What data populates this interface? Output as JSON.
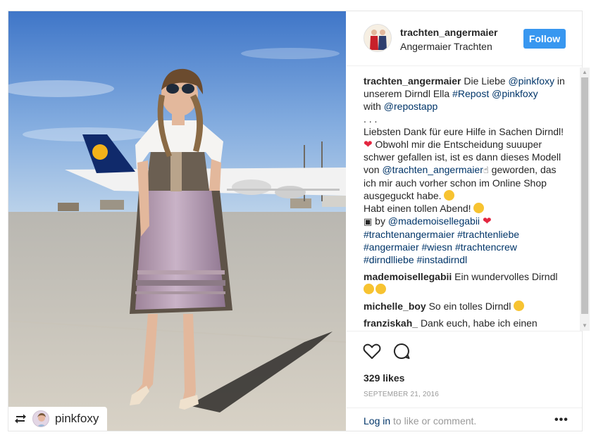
{
  "post": {
    "username": "trachten_angermaier",
    "full_name": "Angermaier Trachten",
    "follow_label": "Follow",
    "repost_from": "pinkfoxy",
    "likes": "329 likes",
    "date": "SEPTEMBER 21, 2016",
    "login_link": "Log in",
    "login_rest": " to like or comment.",
    "more_label": "•••"
  },
  "caption": {
    "user": "trachten_angermaier",
    "line1_text": " Die Liebe ",
    "mention1": "@pinkfoxy",
    "line2_text": " in unserem Dirndl Ella ",
    "tag_repost": "#Repost",
    "mention2": "@pinkfoxy",
    "with_text": "with ",
    "mention3": "@repostapp",
    "dots": ". . .",
    "thanks_text": "Liebsten Dank für eure Hilfe in Sachen Dirndl! ",
    "obwohl_text": " Obwohl mir die Entscheidung suuuper schwer gefallen ist, ist es dann dieses Modell von ",
    "mention4": "@trachten_angermaier",
    "geworden_text": " geworden, das ich mir auch vorher schon im Online Shop ausgeguckt habe. ",
    "abend_text": "Habt einen tollen Abend! ",
    "by_text": " by ",
    "mention5": "@mademoisellegabii",
    "hashtags": [
      "#trachtenangermaier",
      "#trachtenliebe",
      "#angermaier",
      "#wiesn",
      "#trachtencrew",
      "#dirndlliebe",
      "#instadirndl"
    ]
  },
  "comments": [
    {
      "user": "mademoisellegabii",
      "text": "Ein wundervolles Dirndl"
    },
    {
      "user": "michelle_boy",
      "text": "So ein tolles Dirndl"
    },
    {
      "user": "franziskah_",
      "text": "Dank euch, habe ich einen"
    }
  ],
  "icons": {
    "like": "heart-outline-icon",
    "comment": "comment-bubble-icon",
    "repost": "repost-arrows-icon",
    "more": "more-dots-icon"
  },
  "colors": {
    "follow_button": "#3897f0",
    "link": "#003569",
    "muted": "#999999",
    "heart_emoji": "#e3263f"
  }
}
